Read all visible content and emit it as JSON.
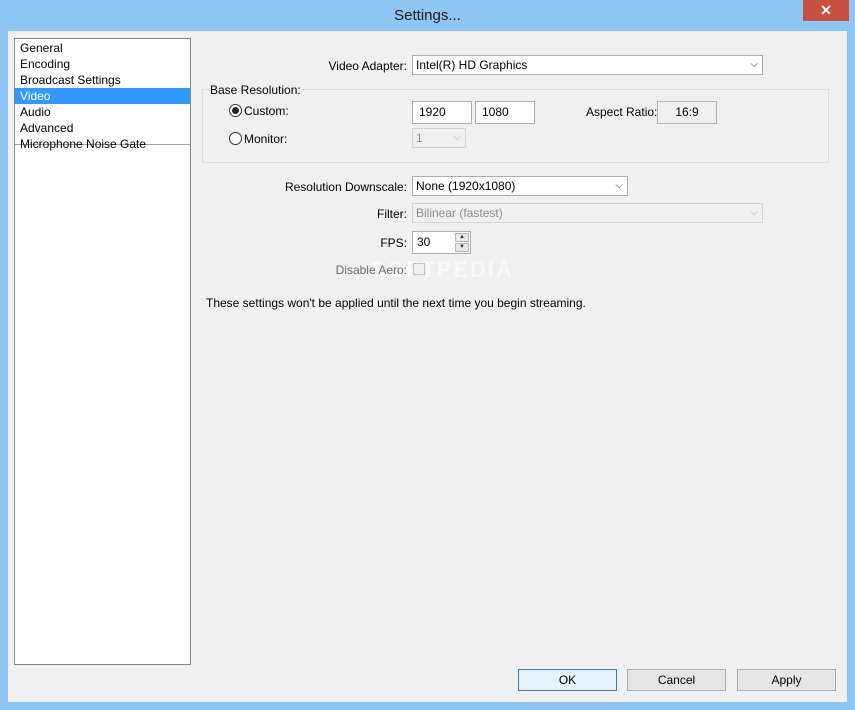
{
  "window": {
    "title": "Settings...",
    "close_glyph": "✕"
  },
  "sidebar": {
    "items": [
      {
        "label": "General"
      },
      {
        "label": "Encoding"
      },
      {
        "label": "Broadcast Settings"
      },
      {
        "label": "Video",
        "selected": true
      },
      {
        "label": "Audio"
      },
      {
        "label": "Advanced"
      },
      {
        "label": "Microphone Noise Gate"
      }
    ]
  },
  "video": {
    "adapter_label": "Video Adapter:",
    "adapter_value": "Intel(R) HD Graphics",
    "base_resolution_label": "Base Resolution:",
    "custom_label": "Custom:",
    "custom_selected": true,
    "width": "1920",
    "height": "1080",
    "aspect_ratio_label": "Aspect Ratio:",
    "aspect_ratio_value": "16:9",
    "monitor_label": "Monitor:",
    "monitor_value": "1",
    "downscale_label": "Resolution Downscale:",
    "downscale_value": "None  (1920x1080)",
    "filter_label": "Filter:",
    "filter_value": "Bilinear (fastest)",
    "fps_label": "FPS:",
    "fps_value": "30",
    "disable_aero_label": "Disable Aero:",
    "notice": "These settings won't be applied until the next time you begin streaming."
  },
  "buttons": {
    "ok": "OK",
    "cancel": "Cancel",
    "apply": "Apply"
  },
  "icons": {
    "chevron": "⌵",
    "spin_up": "▲",
    "spin_down": "▼"
  },
  "colors": {
    "selection": "#3399ff",
    "close": "#c7503f",
    "frame": "#8ec5f3"
  }
}
